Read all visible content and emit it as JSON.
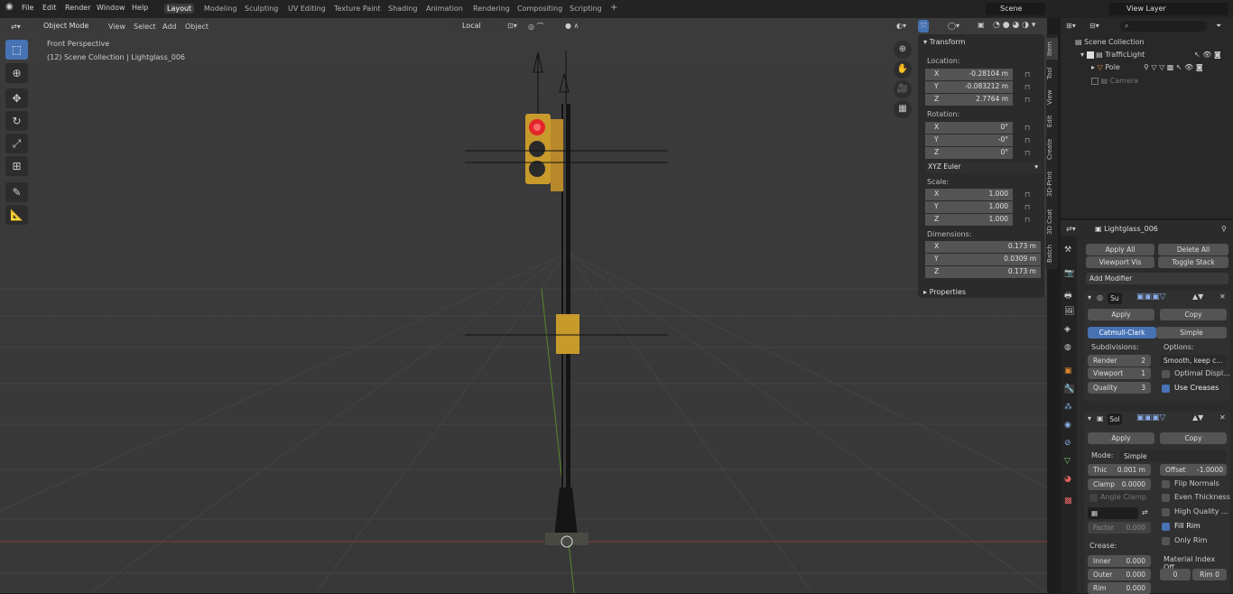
{
  "menu": [
    "File",
    "Edit",
    "Render",
    "Window",
    "Help"
  ],
  "workspaces": [
    "Layout",
    "Modeling",
    "Sculpting",
    "UV Editing",
    "Texture Paint",
    "Shading",
    "Animation",
    "Rendering",
    "Compositing",
    "Scripting"
  ],
  "scene": "Scene",
  "view_layer": "View Layer",
  "vp_header": {
    "mode": "Object Mode",
    "items": [
      "View",
      "Select",
      "Add",
      "Object"
    ],
    "orientation": "Local"
  },
  "viewport": {
    "perspective": "Front Perspective",
    "collection": "(12) Scene Collection | Lightglass_006"
  },
  "npanel": {
    "title": "Transform",
    "location_label": "Location:",
    "rotation_label": "Rotation:",
    "scale_label": "Scale:",
    "dims_label": "Dimensions:",
    "location": [
      {
        "axis": "X",
        "value": "-0.28104 m"
      },
      {
        "axis": "Y",
        "value": "-0.083212 m"
      },
      {
        "axis": "Z",
        "value": "2.7764 m"
      }
    ],
    "rotation": [
      {
        "axis": "X",
        "value": "0°"
      },
      {
        "axis": "Y",
        "value": "-0°"
      },
      {
        "axis": "Z",
        "value": "0°"
      }
    ],
    "rot_mode": "XYZ Euler",
    "scale": [
      {
        "axis": "X",
        "value": "1.000"
      },
      {
        "axis": "Y",
        "value": "1.000"
      },
      {
        "axis": "Z",
        "value": "1.000"
      }
    ],
    "dimensions": [
      {
        "axis": "X",
        "value": "0.173 m"
      },
      {
        "axis": "Y",
        "value": "0.0309 m"
      },
      {
        "axis": "Z",
        "value": "0.173 m"
      }
    ],
    "properties": "Properties"
  },
  "vtabs": [
    "Item",
    "Tool",
    "View",
    "Edit",
    "Create",
    "3D-Print",
    "3D Coat",
    "Batch"
  ],
  "outliner": {
    "root": "Scene Collection",
    "items": [
      "TrafficLight",
      "Pole",
      "Camera"
    ]
  },
  "props": {
    "object": "Lightglass_006",
    "apply_all": "Apply All",
    "delete_all": "Delete All",
    "viewport_vis": "Viewport Vis",
    "toggle_stack": "Toggle Stack",
    "add_modifier": "Add Modifier",
    "mod1": {
      "name": "Su",
      "apply": "Apply",
      "copy": "Copy",
      "catmull": "Catmull-Clark",
      "simple": "Simple",
      "subdivisions": "Subdivisions:",
      "options": "Options:",
      "render": "Render",
      "render_v": "2",
      "viewport": "Viewport",
      "viewport_v": "1",
      "quality": "Quality",
      "quality_v": "3",
      "smooth": "Smooth, keep c...",
      "optimal": "Optimal Displ...",
      "creases": "Use Creases"
    },
    "mod2": {
      "name": "Sol",
      "apply": "Apply",
      "copy": "Copy",
      "mode_label": "Mode:",
      "mode": "Simple",
      "thic": "Thic",
      "thic_v": "0.001 m",
      "offset": "Offset",
      "offset_v": "-1.0000",
      "clamp": "Clamp",
      "clamp_v": "0.0000",
      "flip": "Flip Normals",
      "angle": "Angle Clamp",
      "even": "Even Thickness",
      "high": "High Quality ...",
      "factor": "Factor",
      "factor_v": "0.000",
      "fill": "Fill Rim",
      "only": "Only Rim",
      "crease": "Crease:",
      "inner": "Inner",
      "inner_v": "0.000",
      "outer": "Outer",
      "outer_v": "0.000",
      "rim": "Rim",
      "rim_v": "0.000",
      "mat": "Material Index Off...",
      "mat_v": "0",
      "mat_rim": "Rim",
      "mat_rim_v": "0"
    }
  }
}
